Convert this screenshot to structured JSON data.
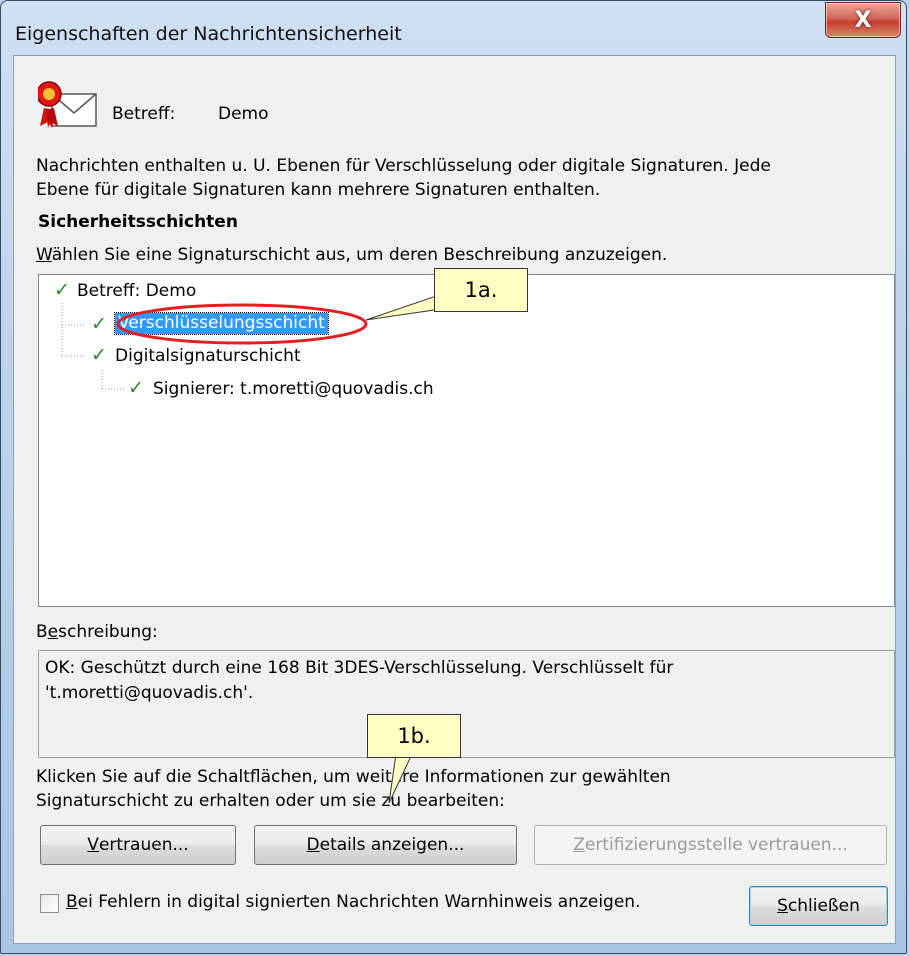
{
  "window": {
    "title": "Eigenschaften der Nachrichtensicherheit",
    "close_glyph": "X"
  },
  "subject": {
    "label": "Betreff:",
    "value": "Demo"
  },
  "intro": {
    "line1": "Nachrichten enthalten u. U. Ebenen für Verschlüsselung oder digitale Signaturen. Jede",
    "line2": "Ebene für digitale Signaturen kann mehrere Signaturen enthalten."
  },
  "layers": {
    "heading": "Sicherheitsschichten",
    "instruction_accesskey": "W",
    "instruction_rest": "ählen Sie eine Signaturschicht aus, um deren Beschreibung anzuzeigen.",
    "tree": [
      {
        "label": "Betreff: Demo",
        "selected": false
      },
      {
        "label": "Verschlüsselungsschicht",
        "selected": true
      },
      {
        "label": "Digitalsignaturschicht",
        "selected": false
      },
      {
        "label": "Signierer: t.moretti@quovadis.ch",
        "selected": false
      }
    ]
  },
  "description": {
    "label_pre": "B",
    "label_accesskey": "e",
    "label_post": "schreibung:",
    "line1": "OK: Geschützt durch eine 168 Bit 3DES-Verschlüsselung. Verschlüsselt für",
    "line2": "'t.moretti@quovadis.ch'."
  },
  "help": {
    "line1": "Klicken Sie auf die Schaltflächen, um weitere Informationen zur gewählten",
    "line2": "Signaturschicht zu erhalten oder um sie zu bearbeiten:"
  },
  "buttons": {
    "trust": {
      "accesskey": "V",
      "rest": "ertrauen..."
    },
    "details": {
      "accesskey": "D",
      "rest": "etails anzeigen..."
    },
    "ca_trust": {
      "accesskey": "Z",
      "rest": "ertifizierungsstelle vertrauen..."
    },
    "close": {
      "accesskey": "S",
      "rest": "chließen"
    }
  },
  "warning": {
    "accesskey": "B",
    "rest": "ei Fehlern in digital signierten Nachrichten Warnhinweis anzeigen.",
    "checked": false
  },
  "annotations": {
    "callout_a": "1a.",
    "callout_b": "1b."
  },
  "colors": {
    "selection": "#3399ff",
    "check": "#2a8a2a",
    "callout_bg": "#ffffc4",
    "highlight_ellipse": "#e02020"
  }
}
